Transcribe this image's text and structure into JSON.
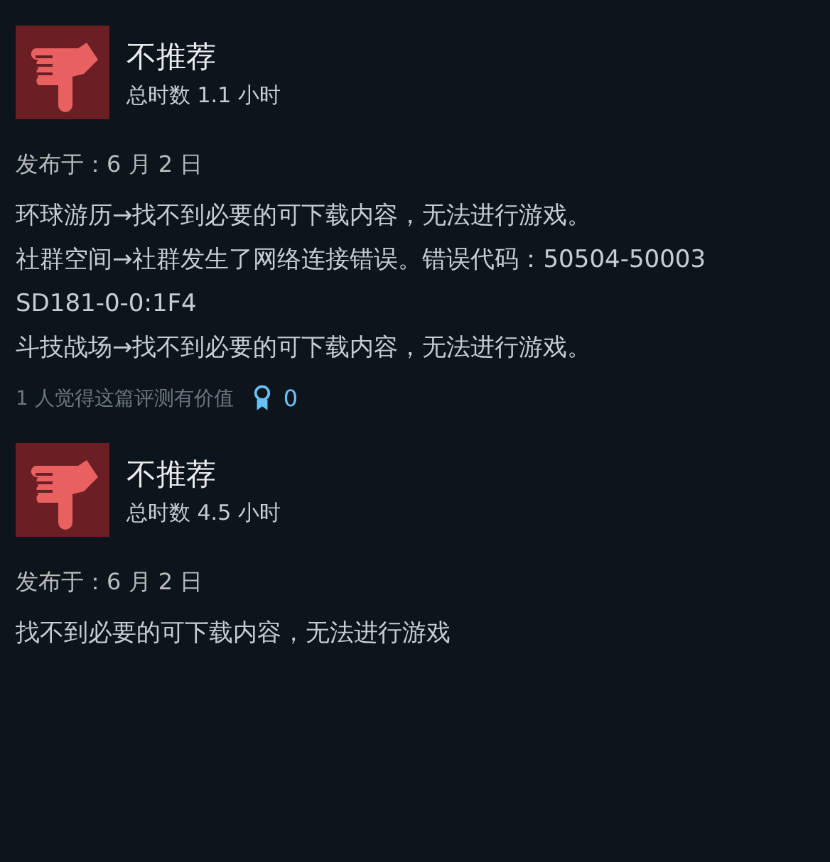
{
  "reviews": [
    {
      "verdict": "不推荐",
      "recommended": false,
      "playtime": "总时数 1.1 小时",
      "posted": "发布于：6 月 2 日",
      "body": [
        "环球游历→找不到必要的可下载内容，无法进行游戏。",
        "社群空间→社群发生了网络连接错误。错误代码：50504-50003",
        "SD181-0-0:1F4",
        "斗技战场→找不到必要的可下载内容，无法进行游戏。"
      ],
      "helpful": "1 人觉得这篇评测有价值",
      "awards": "0"
    },
    {
      "verdict": "不推荐",
      "recommended": false,
      "playtime": "总时数 4.5 小时",
      "posted": "发布于：6 月 2 日",
      "body": [
        "找不到必要的可下载内容，无法进行游戏"
      ]
    }
  ]
}
